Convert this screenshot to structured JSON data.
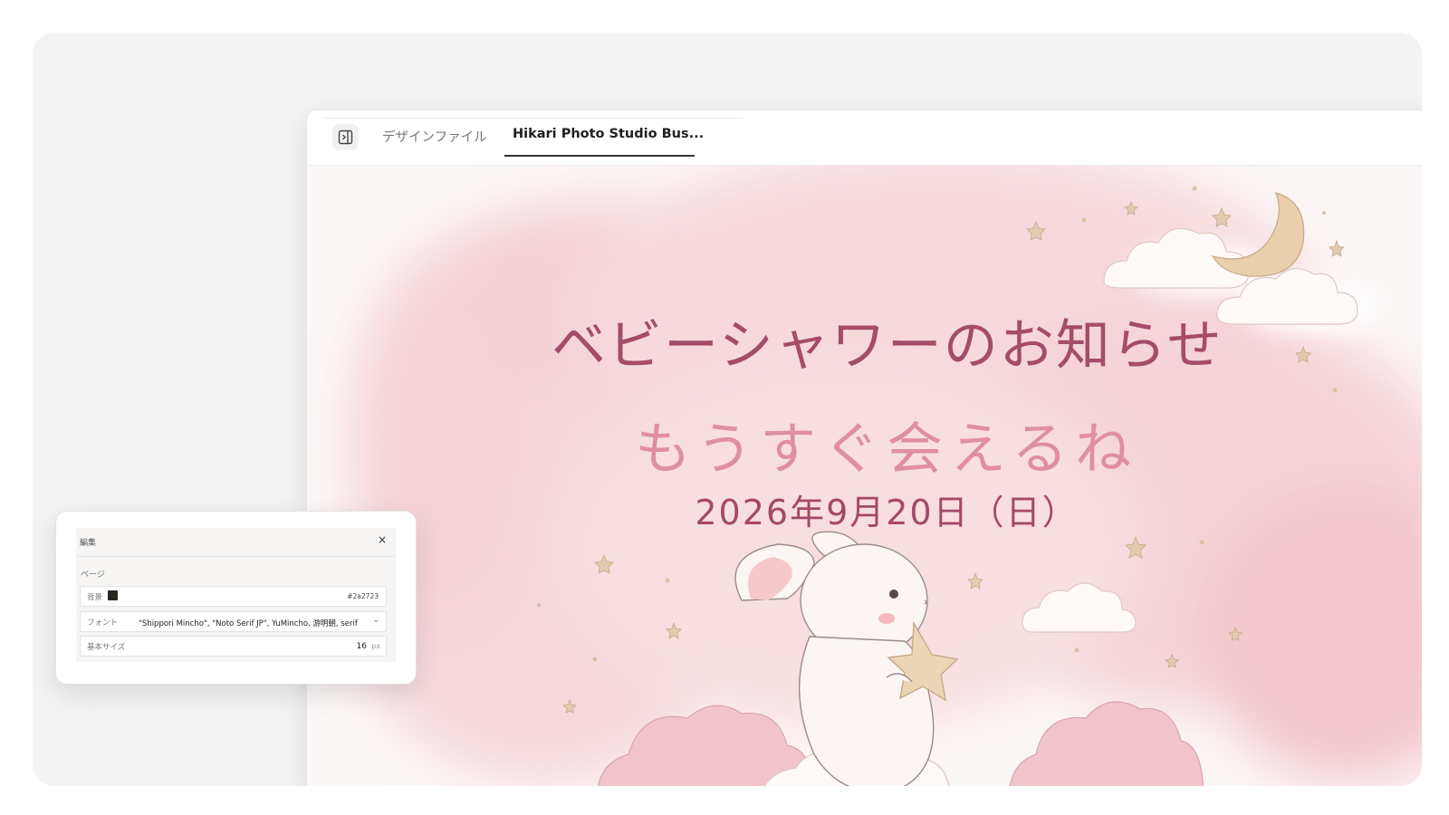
{
  "tabs": [
    {
      "label": "デザインファイル",
      "active": false
    },
    {
      "label": "Hikari Photo Studio Bus...",
      "active": true
    }
  ],
  "sidebar_toggle_icon": "panel-toggle-icon",
  "card": {
    "title": "ベビーシャワーのお知らせ",
    "subtitle": "もうすぐ会えるね",
    "date": "2026年9月20日（日）"
  },
  "edit_panel": {
    "title": "編集",
    "close": "×",
    "section": "ページ",
    "background": {
      "label": "背景",
      "value": "#2a2723"
    },
    "font": {
      "label": "フォント",
      "value": "\"Shippori Mincho\", \"Noto Serif JP\", YuMincho, 游明朝, serif",
      "chevron": "⌄"
    },
    "base_size": {
      "label": "基本サイズ",
      "value": "16",
      "unit": "px"
    }
  },
  "colors": {
    "title": "#a44c6a",
    "subtitle": "#df8f9f",
    "date": "#a5486a",
    "swatch": "#2a2723"
  }
}
